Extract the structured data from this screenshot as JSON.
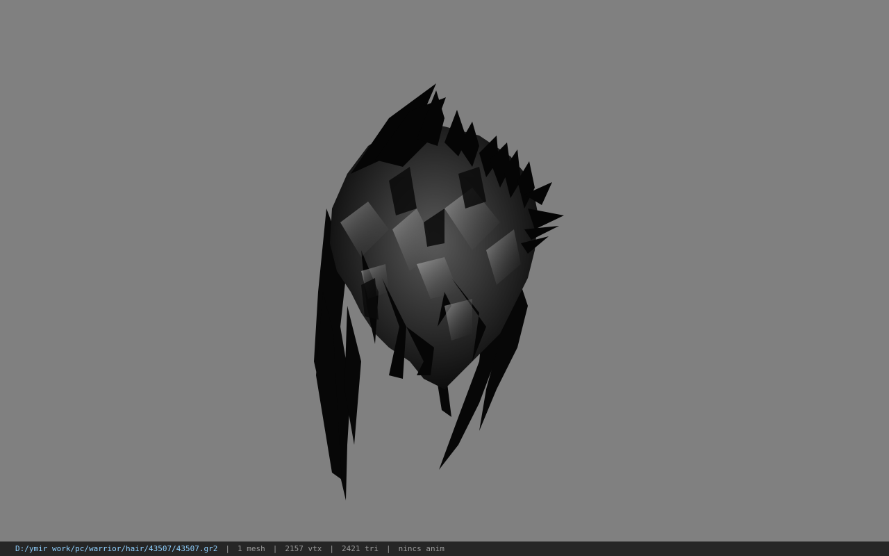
{
  "viewport": {
    "background_color": "#808080",
    "model_subject": "hair-mesh"
  },
  "status_bar": {
    "file_path": "D:/ymir work/pc/warrior/hair/43507/43507.gr2",
    "separator": "|",
    "mesh_count": "1 mesh",
    "vertex_count": "2157 vtx",
    "triangle_count": "2421 tri",
    "animation": "nincs anim",
    "path_color": "#8fd0ff",
    "text_color": "#9a9a9a",
    "background_color": "#262626"
  }
}
